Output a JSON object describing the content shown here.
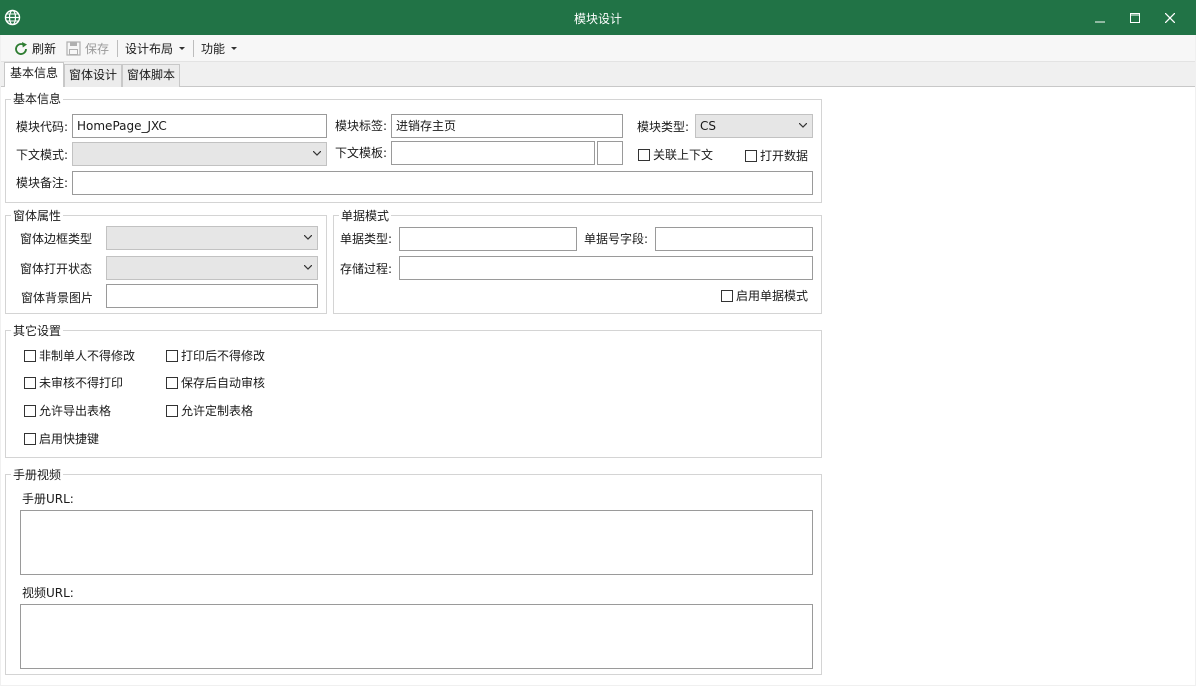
{
  "window": {
    "title": "模块设计",
    "minimize_glyph": "–",
    "maximize_glyph": "☐",
    "close_glyph": "✕"
  },
  "toolbar": {
    "refresh_label": "刷新",
    "save_label": "保存",
    "layout_label": "设计布局",
    "function_label": "功能"
  },
  "tabs": [
    "基本信息",
    "窗体设计",
    "窗体脚本"
  ],
  "basic_info": {
    "group_title": "基本信息",
    "module_code_label": "模块代码:",
    "module_code_value": "HomePage_JXC",
    "module_tag_label": "模块标签:",
    "module_tag_value": "进销存主页",
    "module_type_label": "模块类型:",
    "module_type_value": "CS",
    "context_mode_label": "下文模式:",
    "context_mode_value": "",
    "context_template_label": "下文模板:",
    "context_template_value": "",
    "link_context_label": "关联上下文",
    "open_data_label": "打开数据",
    "remark_label": "模块备注:",
    "remark_value": ""
  },
  "form_props": {
    "group_title": "窗体属性",
    "border_type_label": "窗体边框类型",
    "open_state_label": "窗体打开状态",
    "bg_image_label": "窗体背景图片"
  },
  "doc_mode": {
    "group_title": "单据模式",
    "doc_type_label": "单据类型:",
    "doc_no_field_label": "单据号字段:",
    "stored_proc_label": "存储过程:",
    "enable_label": "启用单据模式"
  },
  "other_settings": {
    "group_title": "其它设置",
    "options": [
      "非制单人不得修改",
      "打印后不得修改",
      "未审核不得打印",
      "保存后自动审核",
      "允许导出表格",
      "允许定制表格",
      "启用快捷键"
    ]
  },
  "manual_video": {
    "group_title": "手册视频",
    "manual_url_label": "手册URL:",
    "video_url_label": "视频URL:"
  },
  "colors": {
    "titlebar": "#217346",
    "panel": "#ffffff",
    "toolbar": "#f7f7f7"
  }
}
